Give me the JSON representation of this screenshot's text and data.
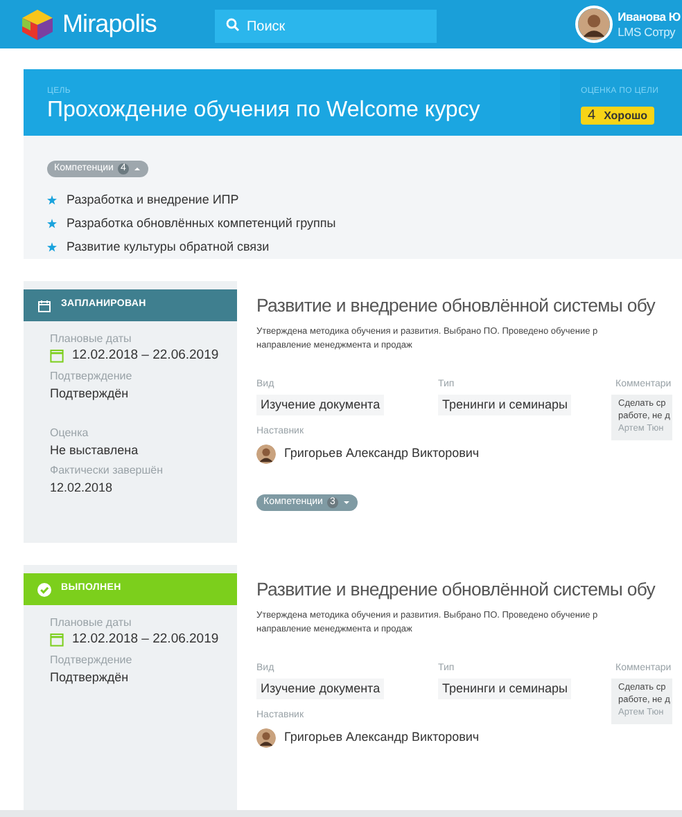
{
  "header": {
    "logo": "Mirapolis",
    "search": {
      "placeholder": "Поиск"
    },
    "user": {
      "name": "Иванова Ю",
      "role": "LMS Сотру"
    }
  },
  "goal": {
    "label": "ЦЕЛЬ",
    "title": "Прохождение обучения по Welcome курсу",
    "rating_label": "ОЦЕНКА ПО ЦЕЛИ",
    "rating": {
      "score": "4",
      "text": "Хорошо"
    },
    "competencies": {
      "label": "Компетенции",
      "count": "4",
      "expanded": true,
      "items": [
        "Разработка и внедрение ИПР",
        "Разработка обновлённых компетенций группы",
        "Развитие культуры обратной связи"
      ]
    }
  },
  "tasks": [
    {
      "status": {
        "kind": "planned",
        "label": "ЗАПЛАНИРОВАН"
      },
      "fields": [
        {
          "kind": "dates",
          "label": "Плановые даты",
          "value": "12.02.2018 – 22.06.2019"
        },
        {
          "kind": "text",
          "label": "Подтверждение",
          "value": "Подтверждён"
        },
        {
          "kind": "gap"
        },
        {
          "kind": "text",
          "label": "Оценка",
          "value": "Не выставлена"
        },
        {
          "kind": "text",
          "label": "Фактически завершён",
          "value": "12.02.2018"
        }
      ],
      "title": "Развитие и внедрение обновлённой системы обу",
      "description": [
        "Утверждена методика обучения и развития. Выбрано ПО. Проведено обучение р",
        "направление менеджмента и продаж"
      ],
      "details": [
        {
          "label": "Вид",
          "value": "Изучение документа"
        },
        {
          "label": "Тип",
          "value": "Тренинги и семинары"
        }
      ],
      "comment": {
        "label": "Комментари",
        "lines": [
          "Сделать ср",
          "работе, не д"
        ],
        "author": "Артем Тюн"
      },
      "mentor": {
        "label": "Наставник",
        "name": "Григорьев Александр Викторович"
      },
      "competencies": {
        "label": "Компетенции",
        "count": "3",
        "expanded": false
      }
    },
    {
      "status": {
        "kind": "done",
        "label": "ВЫПОЛНЕН"
      },
      "fields": [
        {
          "kind": "dates",
          "label": "Плановые даты",
          "value": "12.02.2018 – 22.06.2019"
        },
        {
          "kind": "text",
          "label": "Подтверждение",
          "value": "Подтверждён"
        }
      ],
      "title": "Развитие и внедрение обновлённой системы обу",
      "description": [
        "Утверждена методика обучения и развития. Выбрано ПО. Проведено обучение р",
        "направление менеджмента и продаж"
      ],
      "details": [
        {
          "label": "Вид",
          "value": "Изучение документа"
        },
        {
          "label": "Тип",
          "value": "Тренинги и семинары"
        }
      ],
      "comment": {
        "label": "Комментари",
        "lines": [
          "Сделать ср",
          "работе, не д"
        ],
        "author": "Артем Тюн"
      },
      "mentor": {
        "label": "Наставник",
        "name": "Григорьев Александр Викторович"
      }
    }
  ]
}
